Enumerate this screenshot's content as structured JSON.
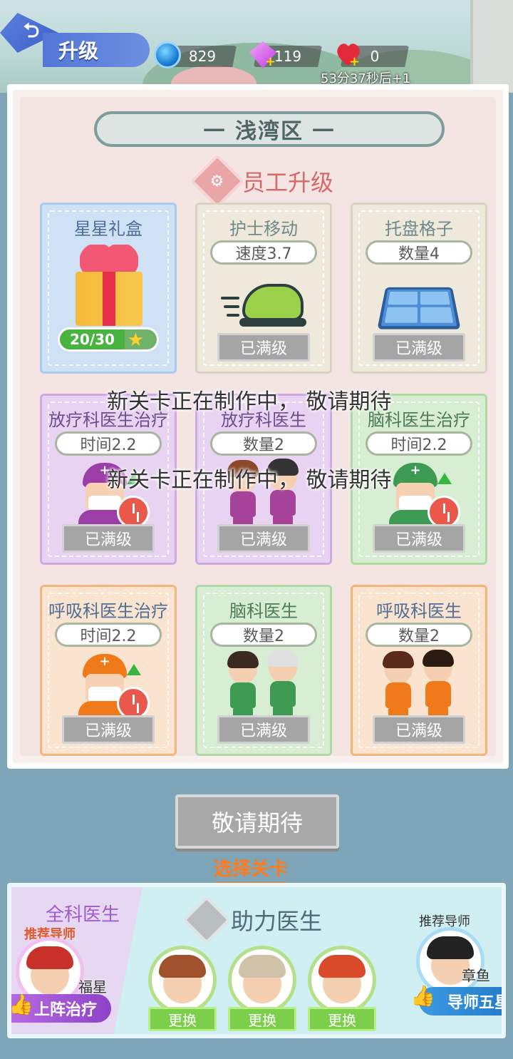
{
  "hud": {
    "title": "升级",
    "gems": "829",
    "diamonds": "119",
    "hearts": "0",
    "heart_timer": "53分37秒后+1"
  },
  "region": {
    "name": "一 浅湾区 一"
  },
  "section": {
    "title": "员工升级"
  },
  "cards": [
    {
      "title": "星星礼盒",
      "progress_text": "20/30",
      "progress": 0.6666
    },
    {
      "title": "护士移动",
      "stat": "速度3.7",
      "status": "已满级"
    },
    {
      "title": "托盘格子",
      "stat": "数量4",
      "status": "已满级"
    },
    {
      "title": "放疗科医生治疗",
      "stat": "时间2.2",
      "status": "已满级"
    },
    {
      "title": "放疗科医生",
      "stat": "数量2",
      "status": "已满级"
    },
    {
      "title": "脑科医生治疗",
      "stat": "时间2.2",
      "status": "已满级"
    },
    {
      "title": "呼吸科医生治疗",
      "stat": "时间2.2",
      "status": "已满级"
    },
    {
      "title": "脑科医生",
      "stat": "数量2",
      "status": "已满级"
    },
    {
      "title": "呼吸科医生",
      "stat": "数量2",
      "status": "已满级"
    }
  ],
  "overlay": {
    "line1": "新关卡正在制作中， 敬请期待",
    "line2": "新关卡正在制作中， 敬请期待"
  },
  "actions": {
    "stay_tuned": "敬请期待",
    "choose_level": "选择关卡"
  },
  "bottom": {
    "gp_title": "全科医生",
    "gp_tag": "推荐导师",
    "gp_name": "福星",
    "deploy": "上阵治疗",
    "helper_title": "助力医生",
    "swap_labels": [
      "更换",
      "更换",
      "更换"
    ],
    "mentor_tag": "推荐导师",
    "mentor_name": "章鱼博士",
    "mentor_btn": "导师五星"
  },
  "colors": {
    "accent_blue": "#5277d6",
    "max_gray": "#a5a5a5",
    "link_orange": "#ff7a1a",
    "swap_green": "#7ccf4a"
  }
}
